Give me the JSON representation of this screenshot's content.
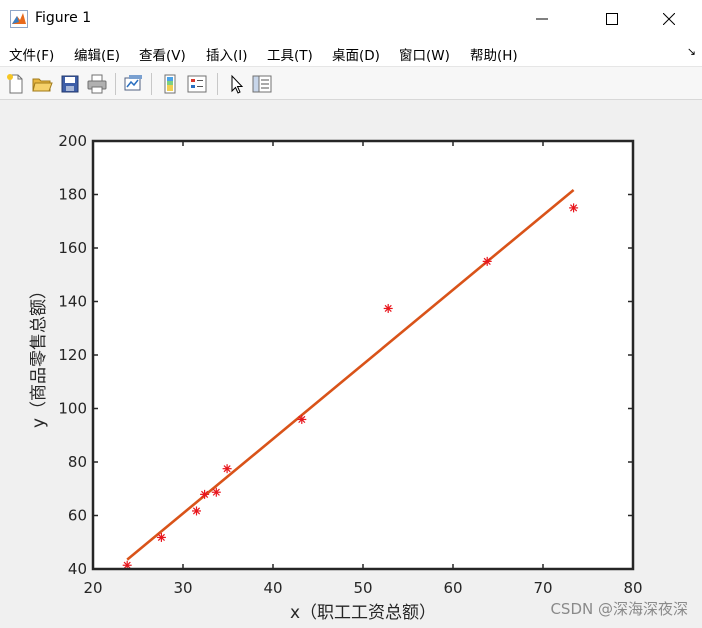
{
  "window": {
    "title": "Figure 1",
    "controls": {
      "minimize": "—",
      "maximize": "☐",
      "close": "✕"
    }
  },
  "menubar": {
    "items": [
      "文件(F)",
      "编辑(E)",
      "查看(V)",
      "插入(I)",
      "工具(T)",
      "桌面(D)",
      "窗口(W)",
      "帮助(H)"
    ],
    "dock_glyph": "↘"
  },
  "toolbar": {
    "buttons": [
      "new-figure-icon",
      "open-file-icon",
      "save-icon",
      "print-icon",
      "link-plot-icon",
      "insert-colorbar-icon",
      "insert-legend-icon",
      "pointer-icon",
      "property-editor-icon"
    ]
  },
  "watermark": "CSDN @深海深夜深",
  "chart_data": {
    "type": "scatter",
    "xlabel": "x（职工工资总额）",
    "ylabel": "y（商品零售总额）",
    "xlim": [
      20,
      80
    ],
    "ylim": [
      40,
      200
    ],
    "xticks": [
      "20",
      "30",
      "40",
      "50",
      "60",
      "70",
      "80"
    ],
    "yticks": [
      "40",
      "60",
      "80",
      "100",
      "120",
      "140",
      "160",
      "180",
      "200"
    ],
    "grid": false,
    "series": [
      {
        "type": "scatter",
        "marker": "*",
        "color": "#e8161d",
        "x": [
          23.8,
          27.6,
          31.5,
          32.4,
          33.7,
          34.9,
          43.2,
          52.8,
          63.8,
          73.4
        ],
        "y": [
          41.4,
          51.8,
          61.7,
          67.9,
          68.7,
          77.5,
          95.9,
          137.4,
          155.0,
          175.0
        ]
      },
      {
        "type": "line",
        "color": "#d95319",
        "x": [
          23.8,
          73.4
        ],
        "y": [
          43.5,
          181.7
        ]
      }
    ]
  }
}
